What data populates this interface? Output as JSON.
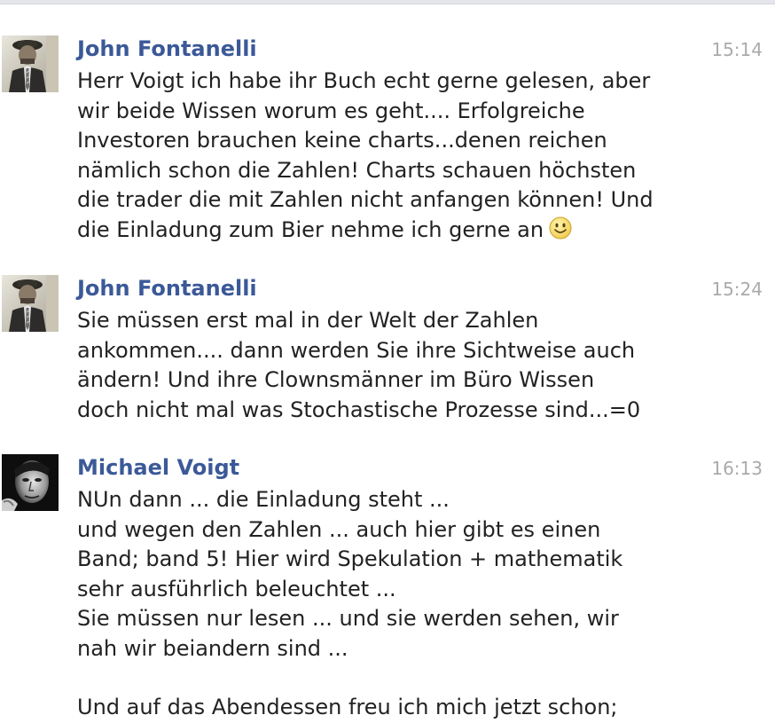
{
  "messages": [
    {
      "author": "John Fontanelli",
      "time": "15:14",
      "avatar_icon": "user-photo-man-hat-tie",
      "paragraphs": [
        [
          "Herr Voigt ich habe ihr Buch echt gerne gelesen, aber",
          "wir beide Wissen worum es geht.... Erfolgreiche",
          "Investoren brauchen keine charts...denen reichen",
          "nämlich schon die Zahlen! Charts schauen höchsten",
          "die trader die mit Zahlen nicht anfangen können! Und",
          "die Einladung zum Bier nehme ich gerne an"
        ]
      ],
      "emoticon": "smiley-face-icon"
    },
    {
      "author": "John Fontanelli",
      "time": "15:24",
      "avatar_icon": "user-photo-man-hat-tie",
      "paragraphs": [
        [
          "Sie müssen erst mal in der Welt der Zahlen",
          "ankommen.... dann werden Sie ihre Sichtweise auch",
          "ändern! Und ihre Clownsmänner im Büro Wissen",
          "doch nicht mal was Stochastische Prozesse sind...=0"
        ]
      ]
    },
    {
      "author": "Michael Voigt",
      "time": "16:13",
      "avatar_icon": "user-photo-man-black-white",
      "paragraphs": [
        [
          "NUn dann ... die Einladung steht ...",
          "und wegen den Zahlen ... auch hier gibt es einen",
          "Band; band 5! Hier wird Spekulation + mathematik",
          "sehr ausführlich beleuchtet ...",
          "Sie müssen nur lesen ... und sie werden sehen, wir",
          "nah wir beiandern sind ..."
        ],
        [
          "Und auf das Abendessen freu ich mich jetzt schon;"
        ]
      ]
    }
  ],
  "colors": {
    "author": "#3b5998",
    "time": "#aaaaaa",
    "text": "#222222",
    "top_border": "#e4e6eb"
  }
}
